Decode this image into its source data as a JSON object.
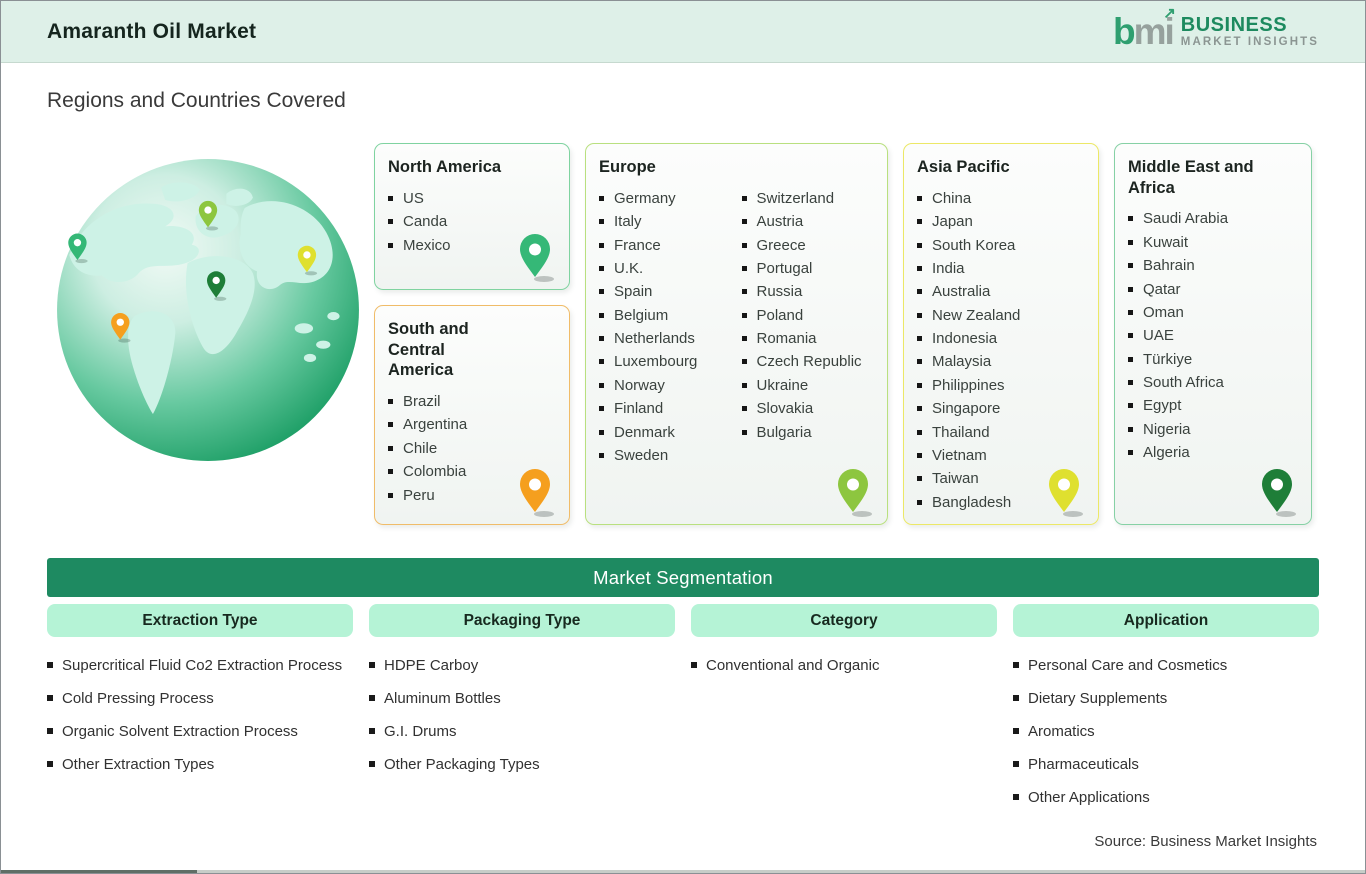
{
  "header": {
    "title": "Amaranth Oil Market",
    "logo": {
      "mark_b": "b",
      "mark_m": "m",
      "mark_i": "i",
      "name_line1": "BUSINESS",
      "name_line2": "MARKET INSIGHTS"
    }
  },
  "section_title": "Regions and Countries Covered",
  "regions": [
    {
      "name": "North America",
      "countries": [
        "US",
        "Canda",
        "Mexico"
      ],
      "accent": "#7fd3a0",
      "pin": "#35b877"
    },
    {
      "name": "South and Central America",
      "countries": [
        "Brazil",
        "Argentina",
        "Chile",
        "Colombia",
        "Peru"
      ],
      "accent": "#f0bc69",
      "pin": "#f59f1e"
    },
    {
      "name": "Europe",
      "countries": [
        "Germany",
        "Italy",
        "France",
        "U.K.",
        "Spain",
        "Belgium",
        "Netherlands",
        "Luxembourg",
        "Norway",
        "Finland",
        "Denmark",
        "Sweden",
        "Switzerland",
        "Austria",
        "Greece",
        "Portugal",
        "Russia",
        "Poland",
        "Romania",
        "Czech Republic",
        "Ukraine",
        "Slovakia",
        "Bulgaria"
      ],
      "accent": "#b9e07f",
      "pin": "#8dc63f"
    },
    {
      "name": "Asia Pacific",
      "countries": [
        "China",
        "Japan",
        "South Korea",
        "India",
        "Australia",
        "New Zealand",
        "Indonesia",
        "Malaysia",
        "Philippines",
        "Singapore",
        "Thailand",
        "Vietnam",
        "Taiwan",
        "Bangladesh"
      ],
      "accent": "#ece867",
      "pin": "#dfe02f"
    },
    {
      "name": "Middle East and Africa",
      "countries": [
        "Saudi Arabia",
        "Kuwait",
        "Bahrain",
        "Qatar",
        "Oman",
        "UAE",
        "Türkiye",
        "South Africa",
        "Egypt",
        "Nigeria",
        "Algeria"
      ],
      "accent": "#86d1a5",
      "pin": "#1e7e38"
    }
  ],
  "segmentation": {
    "banner": "Market Segmentation",
    "columns": [
      {
        "header": "Extraction Type",
        "items": [
          "Supercritical Fluid Co2 Extraction Process",
          "Cold Pressing Process",
          "Organic Solvent Extraction Process",
          "Other Extraction Types"
        ]
      },
      {
        "header": "Packaging Type",
        "items": [
          "HDPE Carboy",
          "Aluminum Bottles",
          "G.I. Drums",
          "Other Packaging Types"
        ]
      },
      {
        "header": "Category",
        "items": [
          "Conventional and Organic"
        ]
      },
      {
        "header": "Application",
        "items": [
          "Personal Care and Cosmetics",
          "Dietary Supplements",
          "Aromatics",
          "Pharmaceuticals",
          "Other Applications"
        ]
      }
    ]
  },
  "source_note": "Source: Business Market Insights",
  "colors": {
    "banner_green": "#1e8a61",
    "pill_mint": "#b5f3d6",
    "header_mint": "#def0e8",
    "logo_green": "#2f9f70",
    "logo_gray": "#96a19d"
  }
}
